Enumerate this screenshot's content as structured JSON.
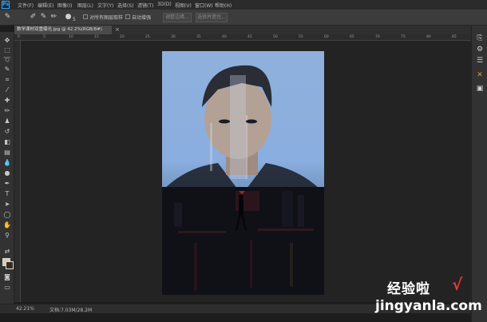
{
  "app": {
    "logo": "Ps"
  },
  "menu": [
    "文件(F)",
    "编辑(E)",
    "图像(I)",
    "图层(L)",
    "文字(Y)",
    "选择(S)",
    "滤镜(T)",
    "3D(D)",
    "视图(V)",
    "窗口(W)",
    "帮助(H)"
  ],
  "options_bar": {
    "brush_size": "5",
    "sample_all_layers": "对所有图层取样",
    "auto_enhance": "自动增强",
    "refine_edge": "调整边缘...",
    "select_subject": "选择并遮住..."
  },
  "document": {
    "tab_title": "数学课材双重曝光.jpg @ 42.2%(RGB/8#)",
    "tab_close": "×",
    "zoom": "42.21%",
    "doc_size": "文档:7.03M/28.2M"
  },
  "ruler_ticks": [
    "0",
    "5",
    "10",
    "15",
    "20",
    "25",
    "30",
    "35",
    "40",
    "45",
    "50",
    "55",
    "60",
    "65",
    "70",
    "75",
    "80",
    "85"
  ],
  "tools": [
    "move-icon",
    "marquee-icon",
    "lasso-icon",
    "quick-select-icon",
    "crop-icon",
    "eyedropper-icon",
    "healing-icon",
    "brush-icon",
    "stamp-icon",
    "history-brush-icon",
    "eraser-icon",
    "gradient-icon",
    "blur-icon",
    "dodge-icon",
    "pen-icon",
    "type-icon",
    "path-select-icon",
    "shape-icon",
    "hand-icon",
    "zoom-icon"
  ],
  "colors": {
    "foreground": "#d8c9b6",
    "background": "#3b2a1e",
    "accent": "#e09a2a"
  },
  "watermark": {
    "text": "经验啦",
    "check": "√",
    "url": "jingyanla.com"
  }
}
